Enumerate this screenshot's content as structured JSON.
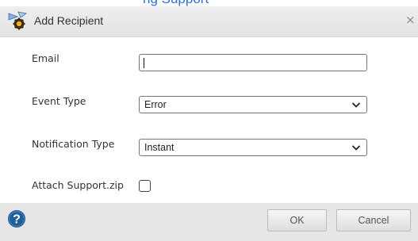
{
  "background_link": {
    "text": "ng Support"
  },
  "dialog": {
    "title": "Add Recipient",
    "close_label": "×",
    "icon": "recipient-icon"
  },
  "form": {
    "email": {
      "label": "Email",
      "value": ""
    },
    "event_type": {
      "label": "Event Type",
      "selected": "Error"
    },
    "notification_type": {
      "label": "Notification Type",
      "selected": "Instant"
    },
    "attach": {
      "label": "Attach Support.zip",
      "checked": false
    }
  },
  "footer": {
    "help_icon": "help-icon",
    "ok_label": "OK",
    "cancel_label": "Cancel"
  },
  "colors": {
    "help_blue": "#1f5f99",
    "link_blue": "#2f6fd6"
  }
}
